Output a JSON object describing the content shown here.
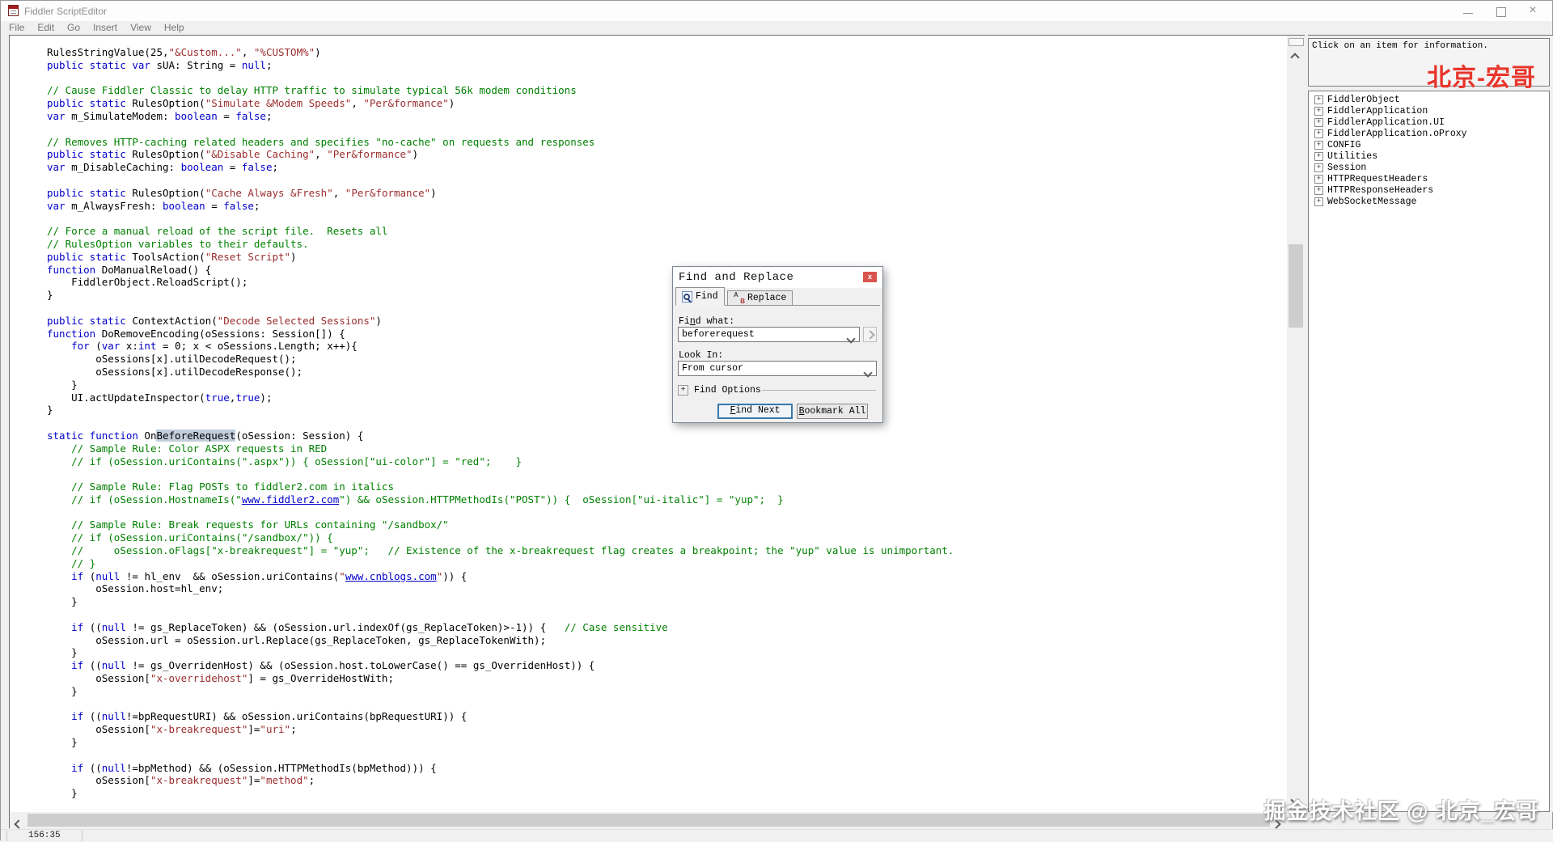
{
  "window": {
    "title": "Fiddler ScriptEditor",
    "controls": {
      "minimize": "minimize",
      "maximize": "maximize",
      "close": "×"
    }
  },
  "menu": {
    "items": [
      "File",
      "Edit",
      "Go",
      "Insert",
      "View",
      "Help"
    ]
  },
  "editor": {
    "lines": [
      {
        "seg": [
          [
            "t",
            "RulesStringValue(25,"
          ],
          [
            "s",
            "\"&Custom...\""
          ],
          [
            "t",
            ", "
          ],
          [
            "s",
            "\"%CUSTOM%\""
          ],
          [
            "t",
            ")"
          ]
        ]
      },
      {
        "seg": [
          [
            "k",
            "public static var"
          ],
          [
            "t",
            " sUA: String = "
          ],
          [
            "k",
            "null"
          ],
          [
            "t",
            ";"
          ]
        ]
      },
      {
        "seg": []
      },
      {
        "seg": [
          [
            "c",
            "// Cause Fiddler Classic to delay HTTP traffic to simulate typical 56k modem conditions"
          ]
        ]
      },
      {
        "seg": [
          [
            "k",
            "public static"
          ],
          [
            "t",
            " RulesOption("
          ],
          [
            "s",
            "\"Simulate &Modem Speeds\""
          ],
          [
            "t",
            ", "
          ],
          [
            "s",
            "\"Per&formance\""
          ],
          [
            "t",
            ")"
          ]
        ]
      },
      {
        "seg": [
          [
            "k",
            "var"
          ],
          [
            "t",
            " m_SimulateModem: "
          ],
          [
            "k",
            "boolean"
          ],
          [
            "t",
            " = "
          ],
          [
            "k",
            "false"
          ],
          [
            "t",
            ";"
          ]
        ]
      },
      {
        "seg": []
      },
      {
        "seg": [
          [
            "c",
            "// Removes HTTP-caching related headers and specifies \"no-cache\" on requests and responses"
          ]
        ]
      },
      {
        "seg": [
          [
            "k",
            "public static"
          ],
          [
            "t",
            " RulesOption("
          ],
          [
            "s",
            "\"&Disable Caching\""
          ],
          [
            "t",
            ", "
          ],
          [
            "s",
            "\"Per&formance\""
          ],
          [
            "t",
            ")"
          ]
        ]
      },
      {
        "seg": [
          [
            "k",
            "var"
          ],
          [
            "t",
            " m_DisableCaching: "
          ],
          [
            "k",
            "boolean"
          ],
          [
            "t",
            " = "
          ],
          [
            "k",
            "false"
          ],
          [
            "t",
            ";"
          ]
        ]
      },
      {
        "seg": []
      },
      {
        "seg": [
          [
            "k",
            "public static"
          ],
          [
            "t",
            " RulesOption("
          ],
          [
            "s",
            "\"Cache Always &Fresh\""
          ],
          [
            "t",
            ", "
          ],
          [
            "s",
            "\"Per&formance\""
          ],
          [
            "t",
            ")"
          ]
        ]
      },
      {
        "seg": [
          [
            "k",
            "var"
          ],
          [
            "t",
            " m_AlwaysFresh: "
          ],
          [
            "k",
            "boolean"
          ],
          [
            "t",
            " = "
          ],
          [
            "k",
            "false"
          ],
          [
            "t",
            ";"
          ]
        ]
      },
      {
        "seg": []
      },
      {
        "seg": [
          [
            "c",
            "// Force a manual reload of the script file.  Resets all"
          ]
        ]
      },
      {
        "seg": [
          [
            "c",
            "// RulesOption variables to their defaults."
          ]
        ]
      },
      {
        "seg": [
          [
            "k",
            "public static"
          ],
          [
            "t",
            " ToolsAction("
          ],
          [
            "s",
            "\"Reset Script\""
          ],
          [
            "t",
            ")"
          ]
        ]
      },
      {
        "seg": [
          [
            "k",
            "function"
          ],
          [
            "t",
            " DoManualReload() {"
          ]
        ]
      },
      {
        "seg": [
          [
            "t",
            "    FiddlerObject.ReloadScript();"
          ]
        ]
      },
      {
        "seg": [
          [
            "t",
            "}"
          ]
        ]
      },
      {
        "seg": []
      },
      {
        "seg": [
          [
            "k",
            "public static"
          ],
          [
            "t",
            " ContextAction("
          ],
          [
            "s",
            "\"Decode Selected Sessions\""
          ],
          [
            "t",
            ")"
          ]
        ]
      },
      {
        "seg": [
          [
            "k",
            "function"
          ],
          [
            "t",
            " DoRemoveEncoding(oSessions: Session[]) {"
          ]
        ]
      },
      {
        "seg": [
          [
            "t",
            "    "
          ],
          [
            "k",
            "for"
          ],
          [
            "t",
            " ("
          ],
          [
            "k",
            "var"
          ],
          [
            "t",
            " x:"
          ],
          [
            "k",
            "int"
          ],
          [
            "t",
            " = 0; x < oSessions.Length; x++){"
          ]
        ]
      },
      {
        "seg": [
          [
            "t",
            "        oSessions[x].utilDecodeRequest();"
          ]
        ]
      },
      {
        "seg": [
          [
            "t",
            "        oSessions[x].utilDecodeResponse();"
          ]
        ]
      },
      {
        "seg": [
          [
            "t",
            "    }"
          ]
        ]
      },
      {
        "seg": [
          [
            "t",
            "    UI.actUpdateInspector("
          ],
          [
            "k",
            "true"
          ],
          [
            "t",
            ","
          ],
          [
            "k",
            "true"
          ],
          [
            "t",
            ");"
          ]
        ]
      },
      {
        "seg": [
          [
            "t",
            "}"
          ]
        ]
      },
      {
        "seg": []
      },
      {
        "seg": [
          [
            "k",
            "static function"
          ],
          [
            "t",
            " On"
          ],
          [
            "sel",
            "BeforeRequest"
          ],
          [
            "t",
            "(oSession: Session) {"
          ]
        ]
      },
      {
        "seg": [
          [
            "t",
            "    "
          ],
          [
            "c",
            "// Sample Rule: Color ASPX requests in RED"
          ]
        ]
      },
      {
        "seg": [
          [
            "t",
            "    "
          ],
          [
            "c",
            "// if (oSession.uriContains(\".aspx\")) { oSession[\"ui-color\"] = \"red\";    }"
          ]
        ]
      },
      {
        "seg": []
      },
      {
        "seg": [
          [
            "t",
            "    "
          ],
          [
            "c",
            "// Sample Rule: Flag POSTs to fiddler2.com in italics"
          ]
        ]
      },
      {
        "seg": [
          [
            "t",
            "    "
          ],
          [
            "c",
            "// if (oSession.HostnameIs(\""
          ],
          [
            "u",
            "www.fiddler2.com"
          ],
          [
            "c",
            "\") && oSession.HTTPMethodIs(\"POST\")) {  oSession[\"ui-italic\"] = \"yup\";  }"
          ]
        ]
      },
      {
        "seg": []
      },
      {
        "seg": [
          [
            "t",
            "    "
          ],
          [
            "c",
            "// Sample Rule: Break requests for URLs containing \"/sandbox/\""
          ]
        ]
      },
      {
        "seg": [
          [
            "t",
            "    "
          ],
          [
            "c",
            "// if (oSession.uriContains(\"/sandbox/\")) {"
          ]
        ]
      },
      {
        "seg": [
          [
            "t",
            "    "
          ],
          [
            "c",
            "//     oSession.oFlags[\"x-breakrequest\"] = \"yup\";   // Existence of the x-breakrequest flag creates a breakpoint; the \"yup\" value is unimportant."
          ]
        ]
      },
      {
        "seg": [
          [
            "t",
            "    "
          ],
          [
            "c",
            "// }"
          ]
        ]
      },
      {
        "seg": [
          [
            "t",
            "    "
          ],
          [
            "k",
            "if"
          ],
          [
            "t",
            " ("
          ],
          [
            "k",
            "null"
          ],
          [
            "t",
            " != hl_env  && oSession.uriContains("
          ],
          [
            "s",
            "\""
          ],
          [
            "u",
            "www.cnblogs.com"
          ],
          [
            "s",
            "\""
          ],
          [
            "t",
            ")) {"
          ]
        ]
      },
      {
        "seg": [
          [
            "t",
            "        oSession.host=hl_env;"
          ]
        ]
      },
      {
        "seg": [
          [
            "t",
            "    }"
          ]
        ]
      },
      {
        "seg": []
      },
      {
        "seg": [
          [
            "t",
            "    "
          ],
          [
            "k",
            "if"
          ],
          [
            "t",
            " (("
          ],
          [
            "k",
            "null"
          ],
          [
            "t",
            " != gs_ReplaceToken) && (oSession.url.indexOf(gs_ReplaceToken)>-1)) {   "
          ],
          [
            "c",
            "// Case sensitive"
          ]
        ]
      },
      {
        "seg": [
          [
            "t",
            "        oSession.url = oSession.url.Replace(gs_ReplaceToken, gs_ReplaceTokenWith);"
          ]
        ]
      },
      {
        "seg": [
          [
            "t",
            "    }"
          ]
        ]
      },
      {
        "seg": [
          [
            "t",
            "    "
          ],
          [
            "k",
            "if"
          ],
          [
            "t",
            " (("
          ],
          [
            "k",
            "null"
          ],
          [
            "t",
            " != gs_OverridenHost) && (oSession.host.toLowerCase() == gs_OverridenHost)) {"
          ]
        ]
      },
      {
        "seg": [
          [
            "t",
            "        oSession["
          ],
          [
            "s",
            "\"x-overridehost\""
          ],
          [
            "t",
            "] = gs_OverrideHostWith;"
          ]
        ]
      },
      {
        "seg": [
          [
            "t",
            "    }"
          ]
        ]
      },
      {
        "seg": []
      },
      {
        "seg": [
          [
            "t",
            "    "
          ],
          [
            "k",
            "if"
          ],
          [
            "t",
            " (("
          ],
          [
            "k",
            "null"
          ],
          [
            "t",
            "!=bpRequestURI) && oSession.uriContains(bpRequestURI)) {"
          ]
        ]
      },
      {
        "seg": [
          [
            "t",
            "        oSession["
          ],
          [
            "s",
            "\"x-breakrequest\""
          ],
          [
            "t",
            "]="
          ],
          [
            "s",
            "\"uri\""
          ],
          [
            "t",
            ";"
          ]
        ]
      },
      {
        "seg": [
          [
            "t",
            "    }"
          ]
        ]
      },
      {
        "seg": []
      },
      {
        "seg": [
          [
            "t",
            "    "
          ],
          [
            "k",
            "if"
          ],
          [
            "t",
            " (("
          ],
          [
            "k",
            "null"
          ],
          [
            "t",
            "!=bpMethod) && (oSession.HTTPMethodIs(bpMethod))) {"
          ]
        ]
      },
      {
        "seg": [
          [
            "t",
            "        oSession["
          ],
          [
            "s",
            "\"x-breakrequest\""
          ],
          [
            "t",
            "]="
          ],
          [
            "s",
            "\"method\""
          ],
          [
            "t",
            ";"
          ]
        ]
      },
      {
        "seg": [
          [
            "t",
            "    }"
          ]
        ]
      }
    ]
  },
  "dialog": {
    "title": "Find and Replace",
    "close_glyph": "x",
    "tabs": [
      "Find",
      "Replace"
    ],
    "find_what_label": {
      "pre": "Fi",
      "accel": "n",
      "post": "d what:"
    },
    "find_value": "beforerequest",
    "look_in_label": "Look In:",
    "look_in_value": "From cursor",
    "options_toggle": "+",
    "options_label": "Find Options",
    "find_next": {
      "accel": "F",
      "rest": "ind Next"
    },
    "bookmark_all": {
      "accel": "B",
      "rest": "ookmark All"
    }
  },
  "panel": {
    "info": "Click on an item for information.",
    "red_watermark": "北京-宏哥",
    "tree": [
      "FiddlerObject",
      "FiddlerApplication",
      "FiddlerApplication.UI",
      "FiddlerApplication.oProxy",
      "CONFIG",
      "Utilities",
      "Session",
      "HTTPRequestHeaders",
      "HTTPResponseHeaders",
      "WebSocketMessage"
    ]
  },
  "statusbar": {
    "position": "156:35"
  },
  "watermark": "掘金技术社区 @ 北京_宏哥",
  "colors": {
    "keyword": "#0000cc",
    "comment": "#008000",
    "string": "#9b2d2e",
    "link": "#0000cc",
    "selection_bg": "#c3cedb",
    "red_watermark": "#e8352b",
    "close_button": "#d9544d",
    "focus_border": "#3879ad"
  }
}
